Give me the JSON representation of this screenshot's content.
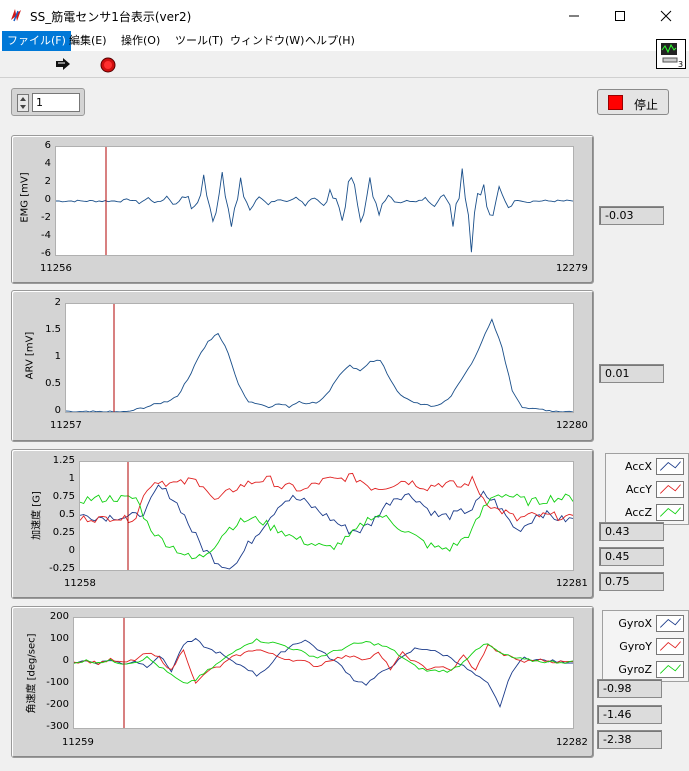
{
  "window": {
    "title": "SS_筋電センサ1台表示(ver2)"
  },
  "menu": [
    {
      "label": "ファイル(F)",
      "active": true
    },
    {
      "label": "編集(E)"
    },
    {
      "label": "操作(O)"
    },
    {
      "label": "ツール(T)"
    },
    {
      "label": "ウィンドウ(W)"
    },
    {
      "label": "ヘルプ(H)"
    }
  ],
  "controls": {
    "sensor_number": "1",
    "stop_label": "停止"
  },
  "colors": {
    "accx": "#1a3a8a",
    "accy": "#e02020",
    "accz": "#10d010",
    "emg": "#1a4f8a",
    "cursor": "#b00000"
  },
  "charts": {
    "emg": {
      "ylabel": "EMG [mV]",
      "x_start": "11256",
      "x_end": "12279",
      "yticks": [
        "6",
        "4",
        "2",
        "0",
        "-2",
        "-4",
        "-6"
      ],
      "value": "-0.03"
    },
    "arv": {
      "ylabel": "ARV [mV]",
      "x_start": "11257",
      "x_end": "12280",
      "yticks": [
        "2",
        "1.5",
        "1",
        "0.5",
        "0"
      ],
      "value": "0.01"
    },
    "acc": {
      "ylabel": "加速度 [G]",
      "x_start": "11258",
      "x_end": "12281",
      "yticks": [
        "1.25",
        "1",
        "0.75",
        "0.5",
        "0.25",
        "0",
        "-0.25"
      ],
      "legend": [
        "AccX",
        "AccY",
        "AccZ"
      ],
      "values": [
        "0.43",
        "0.45",
        "0.75"
      ]
    },
    "gyro": {
      "ylabel": "角速度 [deg/sec]",
      "x_start": "11259",
      "x_end": "12282",
      "yticks": [
        "200",
        "100",
        "0",
        "-100",
        "-200",
        "-300"
      ],
      "legend": [
        "GyroX",
        "GyroY",
        "GyroZ"
      ],
      "values": [
        "-0.98",
        "-1.46",
        "-2.38"
      ]
    }
  },
  "chart_data": [
    {
      "type": "line",
      "ylabel": "EMG [mV]",
      "xlim": [
        11256,
        12279
      ],
      "ylim": [
        -6,
        6
      ],
      "series": [
        {
          "values": [
            0,
            0,
            0,
            0,
            0,
            0,
            0,
            0,
            0.2,
            -0.2,
            0.3,
            -0.3,
            0.5,
            -0.6,
            1.2,
            -1.5,
            2.5,
            -3.0,
            3.5,
            -2.5,
            1.5,
            -1,
            0.5,
            -0.3,
            0.2,
            -0.2,
            0.3,
            -0.3,
            0.6,
            -0.8,
            1.5,
            -2.0,
            2.8,
            -2.2,
            1.6,
            -1.0,
            0.5,
            -0.3,
            0.2,
            -0.2,
            0.4,
            -0.6,
            1.2,
            -1.8,
            3.0,
            -3.5,
            3.2,
            -2.5,
            1.2,
            -0.6,
            0.2,
            -0.1,
            0,
            0,
            0,
            0,
            0
          ]
        }
      ]
    },
    {
      "type": "line",
      "ylabel": "ARV [mV]",
      "xlim": [
        11257,
        12280
      ],
      "ylim": [
        0,
        2
      ],
      "series": [
        {
          "values": [
            0,
            0,
            0,
            0,
            0,
            0,
            0,
            0.05,
            0.1,
            0.15,
            0.2,
            0.3,
            0.6,
            1.0,
            1.3,
            1.45,
            1.1,
            0.5,
            0.2,
            0.15,
            0.1,
            0.15,
            0.1,
            0.2,
            0.15,
            0.2,
            0.4,
            0.7,
            0.85,
            0.75,
            0.95,
            0.95,
            0.6,
            0.3,
            0.2,
            0.15,
            0.1,
            0.15,
            0.3,
            0.6,
            0.9,
            1.3,
            1.7,
            1.2,
            0.4,
            0.1,
            0.05,
            0.05,
            0.02,
            0.01,
            0.01
          ]
        }
      ]
    },
    {
      "type": "line",
      "ylabel": "加速度 [G]",
      "xlim": [
        11258,
        12281
      ],
      "ylim": [
        -0.25,
        1.25
      ],
      "series": [
        {
          "name": "AccX",
          "values": [
            0.5,
            0.5,
            0.48,
            0.5,
            0.48,
            0.5,
            0.6,
            0.9,
            0.8,
            0.6,
            0.3,
            0.05,
            -0.1,
            -0.2,
            -0.15,
            0.1,
            0.3,
            0.5,
            0.7,
            0.75,
            0.7,
            0.6,
            0.5,
            0.4,
            0.3,
            0.3,
            0.4,
            0.6,
            0.75,
            0.8,
            0.75,
            0.6,
            0.5,
            0.5,
            0.55,
            0.6,
            0.8,
            0.7,
            0.5,
            0.3,
            0.4,
            0.55,
            0.5,
            0.45,
            0.45
          ]
        },
        {
          "name": "AccY",
          "values": [
            0.45,
            0.48,
            0.45,
            0.5,
            0.45,
            0.5,
            0.9,
            1.0,
            0.95,
            0.95,
            1.0,
            0.95,
            0.7,
            0.8,
            0.9,
            0.95,
            1.0,
            1.0,
            0.9,
            0.9,
            0.85,
            0.95,
            1.0,
            1.0,
            1.05,
            1.0,
            0.9,
            0.9,
            0.95,
            1.0,
            0.95,
            0.9,
            0.95,
            0.95,
            0.9,
            1.0,
            0.75,
            0.6,
            0.55,
            0.45,
            0.5,
            0.5,
            0.5,
            0.5,
            0.45
          ]
        },
        {
          "name": "AccZ",
          "values": [
            0.72,
            0.74,
            0.74,
            0.75,
            0.74,
            0.75,
            0.4,
            0.2,
            0.1,
            0.0,
            -0.1,
            -0.05,
            0.1,
            0.3,
            0.4,
            0.45,
            0.45,
            0.35,
            0.3,
            0.2,
            0.15,
            0.1,
            0.05,
            0.1,
            0.2,
            0.35,
            0.5,
            0.5,
            0.4,
            0.3,
            0.2,
            0.1,
            0.05,
            0.05,
            0.15,
            0.3,
            0.6,
            0.8,
            0.8,
            0.75,
            0.7,
            0.7,
            0.75,
            0.75,
            0.75
          ]
        }
      ]
    },
    {
      "type": "line",
      "ylabel": "角速度 [deg/sec]",
      "xlim": [
        11259,
        12282
      ],
      "ylim": [
        -300,
        200
      ],
      "series": [
        {
          "name": "GyroX",
          "values": [
            0,
            5,
            -5,
            10,
            -10,
            5,
            -20,
            30,
            -40,
            80,
            100,
            60,
            40,
            0,
            -20,
            -60,
            -20,
            40,
            80,
            100,
            60,
            20,
            -20,
            -80,
            -100,
            -60,
            -20,
            20,
            60,
            60,
            40,
            20,
            -20,
            -60,
            -100,
            -200,
            -40,
            20,
            10,
            5,
            0,
            0
          ]
        },
        {
          "name": "GyroY",
          "values": [
            0,
            5,
            -5,
            10,
            -5,
            10,
            40,
            20,
            -40,
            60,
            -100,
            -40,
            -20,
            20,
            40,
            60,
            40,
            20,
            10,
            0,
            -20,
            10,
            20,
            30,
            10,
            40,
            -30,
            40,
            0,
            -30,
            -20,
            -40,
            30,
            -40,
            80,
            40,
            20,
            0,
            10,
            5,
            0,
            0
          ]
        },
        {
          "name": "GyroZ",
          "values": [
            0,
            5,
            0,
            5,
            -5,
            0,
            20,
            -20,
            -60,
            -100,
            -80,
            -40,
            0,
            40,
            80,
            100,
            90,
            80,
            60,
            40,
            20,
            40,
            60,
            80,
            90,
            80,
            60,
            20,
            -20,
            -40,
            -40,
            -40,
            0,
            60,
            80,
            40,
            20,
            10,
            5,
            0,
            0,
            0
          ]
        }
      ]
    }
  ]
}
